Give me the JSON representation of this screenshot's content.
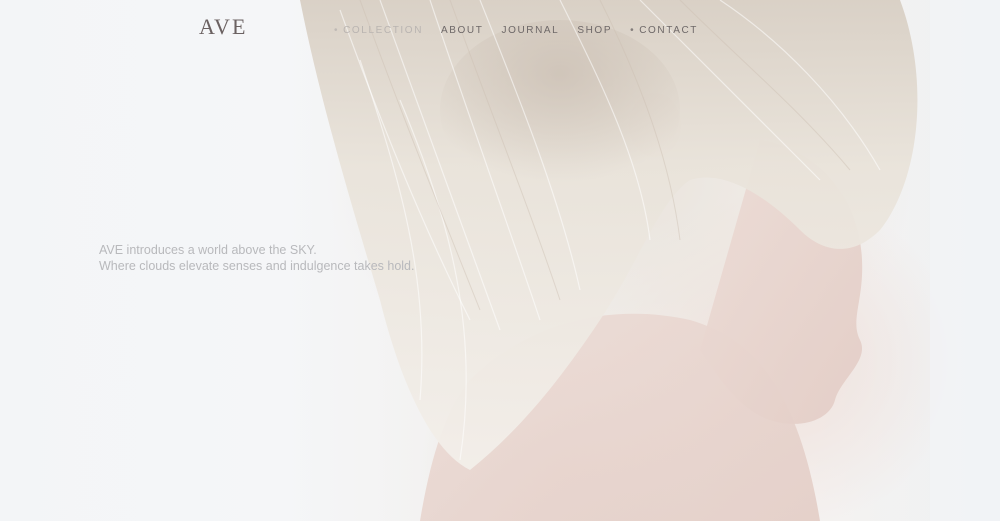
{
  "brand": {
    "logo_text": "AVE"
  },
  "nav": {
    "items": [
      {
        "label": "COLLECTION",
        "prefix": "•",
        "faded": true
      },
      {
        "label": "ABOUT",
        "prefix": "",
        "faded": false
      },
      {
        "label": "JOURNAL",
        "prefix": "",
        "faded": false
      },
      {
        "label": "SHOP",
        "prefix": "",
        "faded": false
      },
      {
        "label": "CONTACT",
        "prefix": "•",
        "faded": false
      }
    ]
  },
  "hero": {
    "image_desc_icon": "hero-portrait-image",
    "tagline_line1": "AVE introduces a world above the SKY.",
    "tagline_line2": "Where clouds elevate senses and indulgence takes hold."
  },
  "colors": {
    "logo": "#6b6262",
    "nav_text": "#6e6868",
    "nav_faded": "#b9b4b1",
    "tagline": "#b8b9bc",
    "background": "#f4f6f8"
  }
}
